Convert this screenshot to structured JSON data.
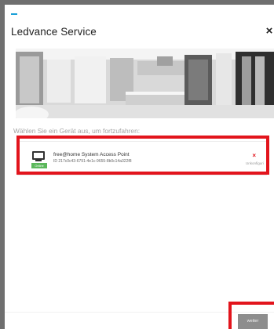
{
  "dialog": {
    "title": "Ledvance Service",
    "close_icon": "close-icon",
    "instruction": "Wählen Sie ein Gerät aus, um fortzufahren:"
  },
  "device": {
    "name": "free@home System Access Point",
    "id_text": "ID 217c0c43-6791-4e1c-9655-8b0c14a322f8",
    "status_badge": "Online",
    "unconfigure_label": "Unkonfiguri",
    "icon": "monitor-icon"
  },
  "footer": {
    "next_label": "weiter"
  },
  "colors": {
    "accent": "#1aa0d8",
    "highlight": "#e2141c",
    "button": "#8d8d8d",
    "status_online": "#5cb85c"
  }
}
